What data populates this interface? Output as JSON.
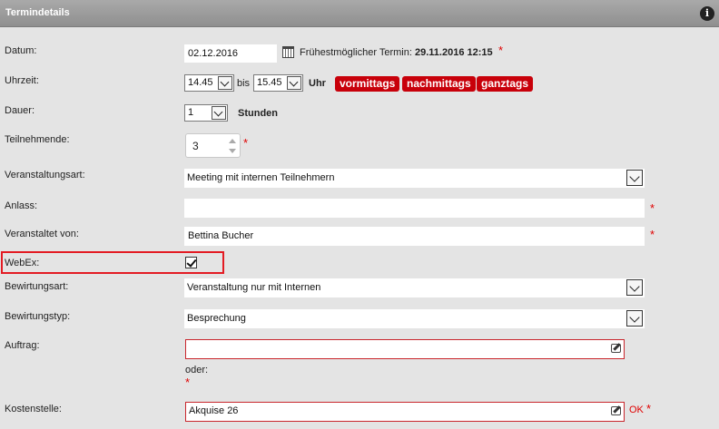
{
  "header": {
    "title": "Termindetails",
    "info_icon": "info-icon"
  },
  "datum": {
    "label": "Datum:",
    "value": "02.12.2016",
    "calendar_icon": "calendar-icon",
    "earliest_label": "Frühestmöglicher Termin:",
    "earliest_value": "29.11.2016 12:15",
    "required": "*"
  },
  "uhrzeit": {
    "label": "Uhrzeit:",
    "from": "14.45",
    "bis": "bis",
    "to": "15.45",
    "unit": "Uhr",
    "buttons": [
      "vormittags",
      "nachmittags",
      "ganztags"
    ]
  },
  "dauer": {
    "label": "Dauer:",
    "value": "1",
    "unit": "Stunden"
  },
  "teilnehmende": {
    "label": "Teilnehmende:",
    "value": "3",
    "required": "*"
  },
  "veranstaltungsart": {
    "label": "Veranstaltungsart:",
    "value": "Meeting mit internen Teilnehmern"
  },
  "anlass": {
    "label": "Anlass:",
    "value": "",
    "required": "*"
  },
  "veranstaltet_von": {
    "label": "Veranstaltet von:",
    "value": "Bettina Bucher",
    "required": "*"
  },
  "webex": {
    "label": "WebEx:",
    "checked": true
  },
  "bewirtungsart": {
    "label": "Bewirtungsart:",
    "value": "Veranstaltung nur mit Internen"
  },
  "bewirtungstyp": {
    "label": "Bewirtungstyp:",
    "value": "Besprechung"
  },
  "auftrag": {
    "label": "Auftrag:",
    "value": "",
    "oder": "oder:",
    "required": "*"
  },
  "kostenstelle": {
    "label": "Kostenstelle:",
    "value": "Akquise 26",
    "status": "OK",
    "required": "*"
  },
  "colors": {
    "accent_red": "#c8000a",
    "required_red": "#e00000",
    "background": "#e4e4e4",
    "header": "#999999"
  }
}
